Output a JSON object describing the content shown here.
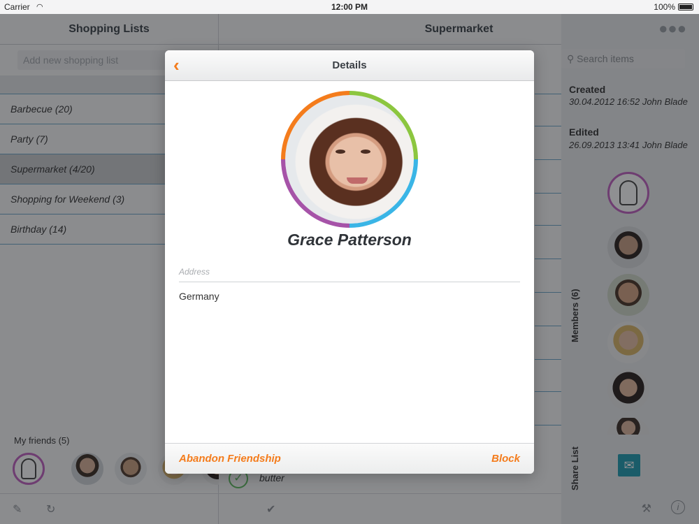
{
  "status_bar": {
    "carrier": "Carrier",
    "time": "12:00 PM",
    "battery": "100%"
  },
  "left_pane": {
    "title": "Shopping Lists",
    "add_placeholder": "Add new shopping list",
    "lists": [
      {
        "label": "Barbecue (20)",
        "selected": false
      },
      {
        "label": "Party (7)",
        "selected": false
      },
      {
        "label": "Supermarket (4/20)",
        "selected": true
      },
      {
        "label": "Shopping for Weekend (3)",
        "selected": false
      },
      {
        "label": "Birthday (14)",
        "selected": false
      }
    ],
    "friends_label": "My friends (5)"
  },
  "main_pane": {
    "title": "Supermarket",
    "search_placeholder": "Search items",
    "visible_item": "butter"
  },
  "info_panel": {
    "created_label": "Created",
    "created_value": "30.04.2012 16:52 John Blade",
    "edited_label": "Edited",
    "edited_value": "26.09.2013 13:41 John Blade",
    "members_label": "Members (6)",
    "share_label": "Share List"
  },
  "modal": {
    "title": "Details",
    "contact_name": "Grace Patterson",
    "address_label": "Address",
    "address_value": "Germany",
    "abandon_label": "Abandon Friendship",
    "block_label": "Block"
  },
  "colors": {
    "accent_orange": "#f47c1c",
    "ring_green": "#8cc63f",
    "ring_blue": "#3ab5e6",
    "ring_purple": "#a653a8",
    "share_teal": "#1f9bb0"
  },
  "icons": [
    "back-chevron-icon",
    "group-icon",
    "search-icon",
    "pencil-icon",
    "sync-icon",
    "checkmark-icon",
    "tools-icon",
    "info-icon",
    "mail-icon"
  ]
}
